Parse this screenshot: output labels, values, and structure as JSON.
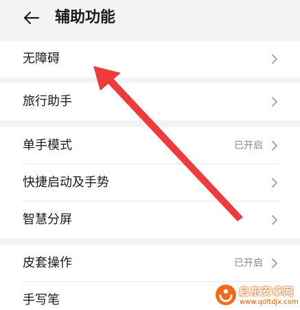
{
  "header": {
    "title": "辅助功能",
    "back_icon": "arrow-left-icon"
  },
  "groups": [
    {
      "items": [
        {
          "label": "无障碍",
          "value": ""
        }
      ]
    },
    {
      "items": [
        {
          "label": "旅行助手",
          "value": ""
        }
      ]
    },
    {
      "items": [
        {
          "label": "单手模式",
          "value": "已开启"
        },
        {
          "label": "快捷启动及手势",
          "value": ""
        },
        {
          "label": "智慧分屏",
          "value": ""
        }
      ]
    },
    {
      "items": [
        {
          "label": "皮套操作",
          "value": "已开启"
        },
        {
          "label": "手写笔",
          "value": ""
        }
      ]
    }
  ],
  "annotation": {
    "arrow_color": "#ee3b3b"
  },
  "watermark": {
    "title": "启东安卓网",
    "url": "www.qdltdjx.com",
    "accent_color": "#e65a00"
  },
  "colors": {
    "background": "#f1f3f5",
    "card": "#ffffff",
    "secondary_text": "#8a8a8a"
  }
}
